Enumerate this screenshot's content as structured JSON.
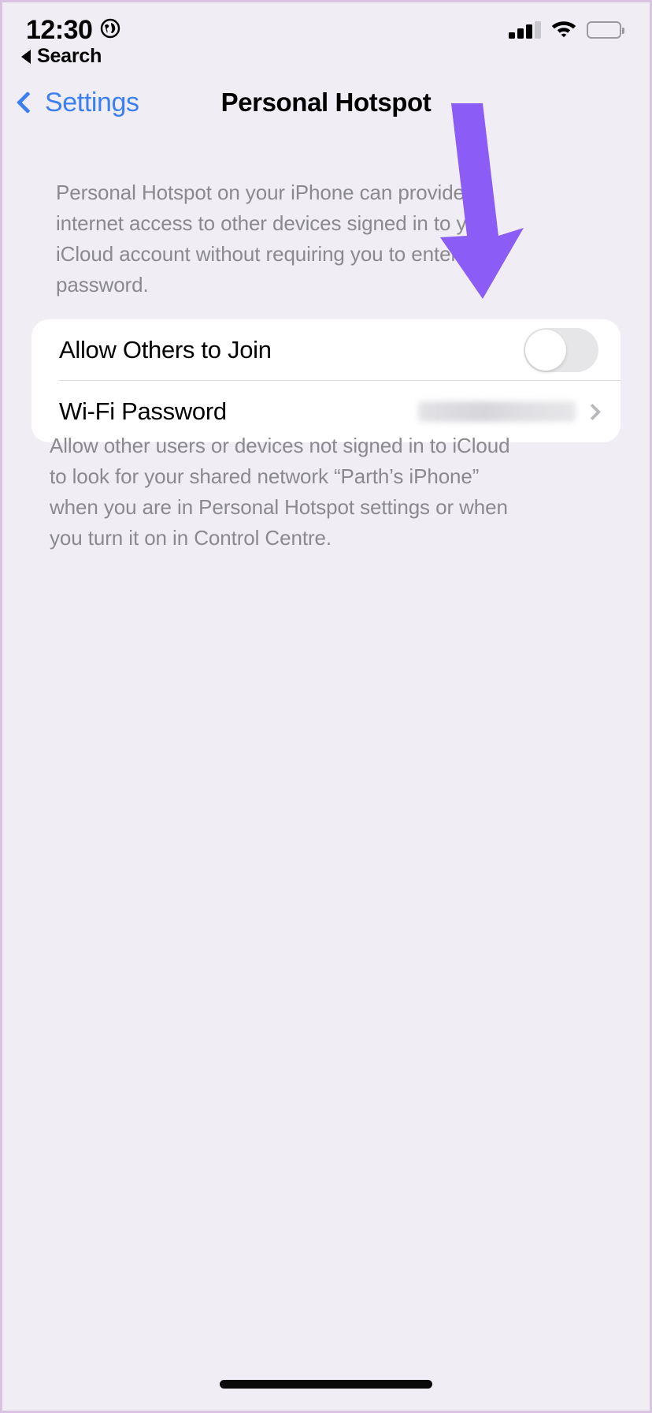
{
  "status_bar": {
    "time": "12:30",
    "location_icon": "globe-icon",
    "cellular_icon": "cellular-signal-icon",
    "cellular_bars_total": 4,
    "cellular_bars_active": 3,
    "wifi_icon": "wifi-icon",
    "battery_icon": "battery-full-icon"
  },
  "back_to_search": {
    "label": "Search",
    "icon": "triangle-left-icon"
  },
  "nav_bar": {
    "back_label": "Settings",
    "back_icon": "chevron-left-icon",
    "title": "Personal Hotspot"
  },
  "header_note": "Personal Hotspot on your iPhone can provide internet access to other devices signed in to your iCloud account without requiring you to enter the password.",
  "card": {
    "rows": [
      {
        "label": "Allow Others to Join",
        "control": "toggle",
        "toggle_state": "off"
      },
      {
        "label": "Wi-Fi Password",
        "control": "disclosure",
        "value": "",
        "value_redacted": true,
        "chevron_icon": "chevron-right-icon"
      }
    ]
  },
  "footer_note": "Allow other users or devices not signed in to iCloud to look for your shared network “Parth’s iPhone” when you are in Personal Hotspot settings or when you turn it on in Control Centre.",
  "annotation": {
    "type": "arrow",
    "color": "#8b5cf6",
    "points_to": "Allow Others to Join toggle"
  },
  "colors": {
    "background": "#f0eef4",
    "card": "#ffffff",
    "accent_blue": "#3b7ff0",
    "secondary_text": "#8a8a8e",
    "annotation_purple": "#8b5cf6"
  },
  "home_indicator": "home-indicator"
}
